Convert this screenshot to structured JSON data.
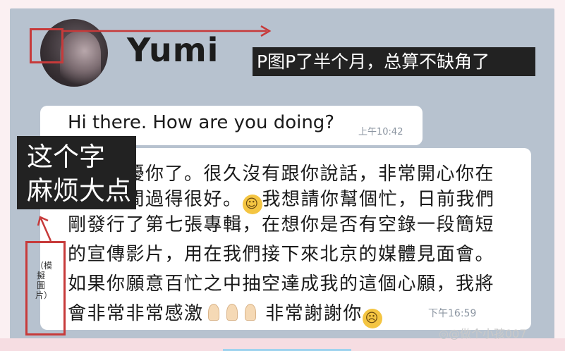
{
  "contact": {
    "name": "Yumi"
  },
  "captions": {
    "top": "P图P了半个月，总算不缺角了",
    "left_line1": "这个字",
    "left_line2": "麻烦大点"
  },
  "messages": [
    {
      "text": "Hi there. How are you doing?",
      "time": "上午10:42"
    },
    {
      "lines": [
        "抱歉打擾你了。很久沒有跟你說話，非常開心你在",
        "這段時間過得很好。",
        "我想請你幫個忙，日前我們",
        "剛發行了第七張專輯，在想你是否有空錄一段簡短",
        "的宣傳影片，用在我們接下來北京的媒體見面會。",
        "如果你願意百忙之中抽空達成我的這個心願，我將",
        "會非常非常感激",
        "非常謝謝你"
      ],
      "time": "下午16:59"
    }
  ],
  "side_label": "（模擬圖片）",
  "watermark": "@做个小孩007",
  "icons": [
    "avatar-photo",
    "smile-emoji",
    "praying-hands-emoji",
    "crying-emoji",
    "weibo-icon"
  ],
  "colors": {
    "chat_bg": "#b7c2cf",
    "caption_bg": "#222222",
    "annotation_red": "#c73a3a"
  }
}
